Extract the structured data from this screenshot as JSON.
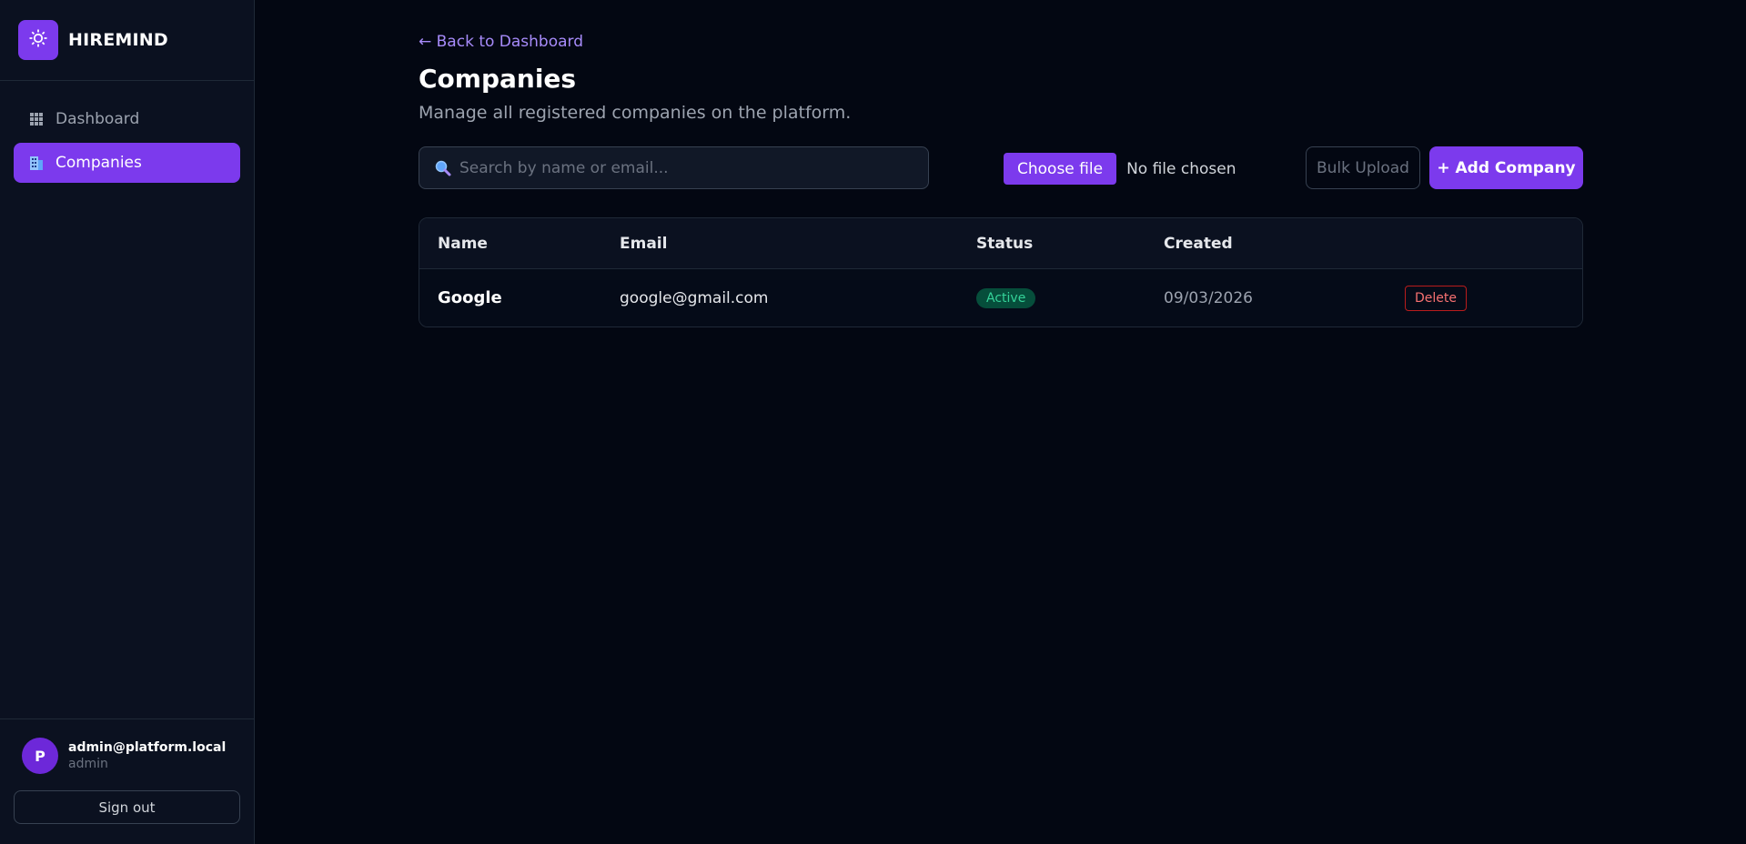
{
  "brand": {
    "name": "HIREMIND",
    "logo_icon": "gear-icon",
    "accent": "#7c3aed"
  },
  "sidebar": {
    "items": [
      {
        "label": "Dashboard",
        "icon": "grid-icon",
        "active": false
      },
      {
        "label": "Companies",
        "icon": "building-icon",
        "active": true
      }
    ],
    "user": {
      "avatar_letter": "P",
      "email": "admin@platform.local",
      "role": "admin"
    },
    "signout_label": "Sign out"
  },
  "main": {
    "back_link": "← Back to Dashboard",
    "title": "Companies",
    "subtitle": "Manage all registered companies on the platform.",
    "search": {
      "placeholder": "Search by name or email...",
      "value": ""
    },
    "file_input": {
      "button_label": "Choose file",
      "status": "No file chosen"
    },
    "bulk_upload_label": "Bulk Upload",
    "add_company_label": "+ Add Company",
    "table": {
      "columns": [
        "Name",
        "Email",
        "Status",
        "Created"
      ],
      "rows": [
        {
          "name": "Google",
          "email": "google@gmail.com",
          "status": "Active",
          "created": "09/03/2026",
          "action": "Delete"
        }
      ]
    }
  },
  "colors": {
    "background": "#030712",
    "sidebar": "#0b1120",
    "accent": "#7c3aed",
    "status_active": "#34d399",
    "danger": "#f87171"
  }
}
